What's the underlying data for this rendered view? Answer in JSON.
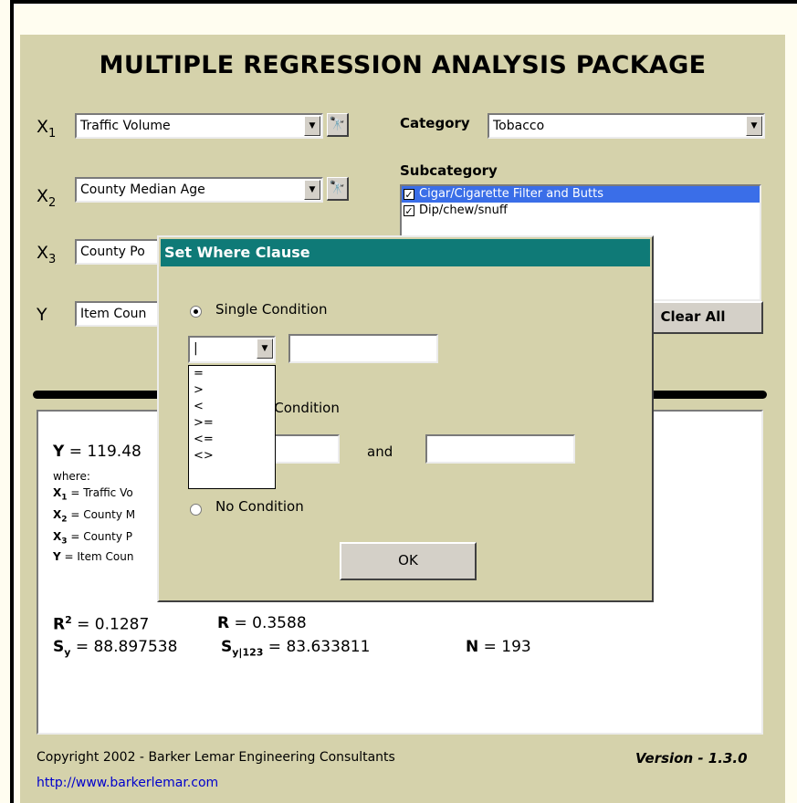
{
  "app": {
    "title": "MULTIPLE REGRESSION ANALYSIS PACKAGE",
    "variables": [
      {
        "label": "X",
        "sub": "1",
        "value": "Traffic Volume"
      },
      {
        "label": "X",
        "sub": "2",
        "value": "County Median Age"
      },
      {
        "label": "X",
        "sub": "3",
        "value": "County Po"
      },
      {
        "label": "Y",
        "sub": "",
        "value": "Item Coun"
      }
    ],
    "category": {
      "label": "Category",
      "value": "Tobacco"
    },
    "subcategory": {
      "label": "Subcategory",
      "items": [
        {
          "label": "Cigar/Cigarette Filter and Butts",
          "checked": true,
          "selected": true
        },
        {
          "label": "Dip/chew/snuff",
          "checked": true,
          "selected": false
        }
      ]
    },
    "clear_all": "Clear All",
    "icons": {
      "binoculars": "binoculars-icon",
      "dropdown": "chevron-down-icon"
    }
  },
  "results": {
    "equation": {
      "lhs": "Y",
      "rhs": " = 119.48"
    },
    "where": "where:",
    "defs": [
      {
        "var": "X",
        "sub": "1",
        "text": " = Traffic Vo"
      },
      {
        "var": "X",
        "sub": "2",
        "text": " = County M"
      },
      {
        "var": "X",
        "sub": "3",
        "text": " = County P"
      },
      {
        "var": "Y",
        "sub": "",
        "text": " = Item Coun"
      }
    ],
    "r2": {
      "label": "R",
      "sup": "2",
      "value": " = 0.1287"
    },
    "r": {
      "label": "R",
      "value": " = 0.3588"
    },
    "sy": {
      "label": "S",
      "sub": "y",
      "value": " = 88.897538"
    },
    "sy123": {
      "label": "S",
      "sub": "y|123",
      "value": " = 83.633811"
    },
    "n": {
      "label": "N",
      "value": " = 193"
    }
  },
  "footer": {
    "copyright": "Copyright 2002 - Barker Lemar Engineering Consultants",
    "version": "Version - 1.3.0",
    "url": "http://www.barkerlemar.com"
  },
  "dialog": {
    "title": "Set Where Clause",
    "single": "Single Condition",
    "between": "n Condition",
    "and": "and",
    "none": "No Condition",
    "ok": "OK",
    "operators": [
      "=",
      ">",
      "<",
      ">=",
      "<=",
      "<>"
    ],
    "selected_option": "single"
  }
}
